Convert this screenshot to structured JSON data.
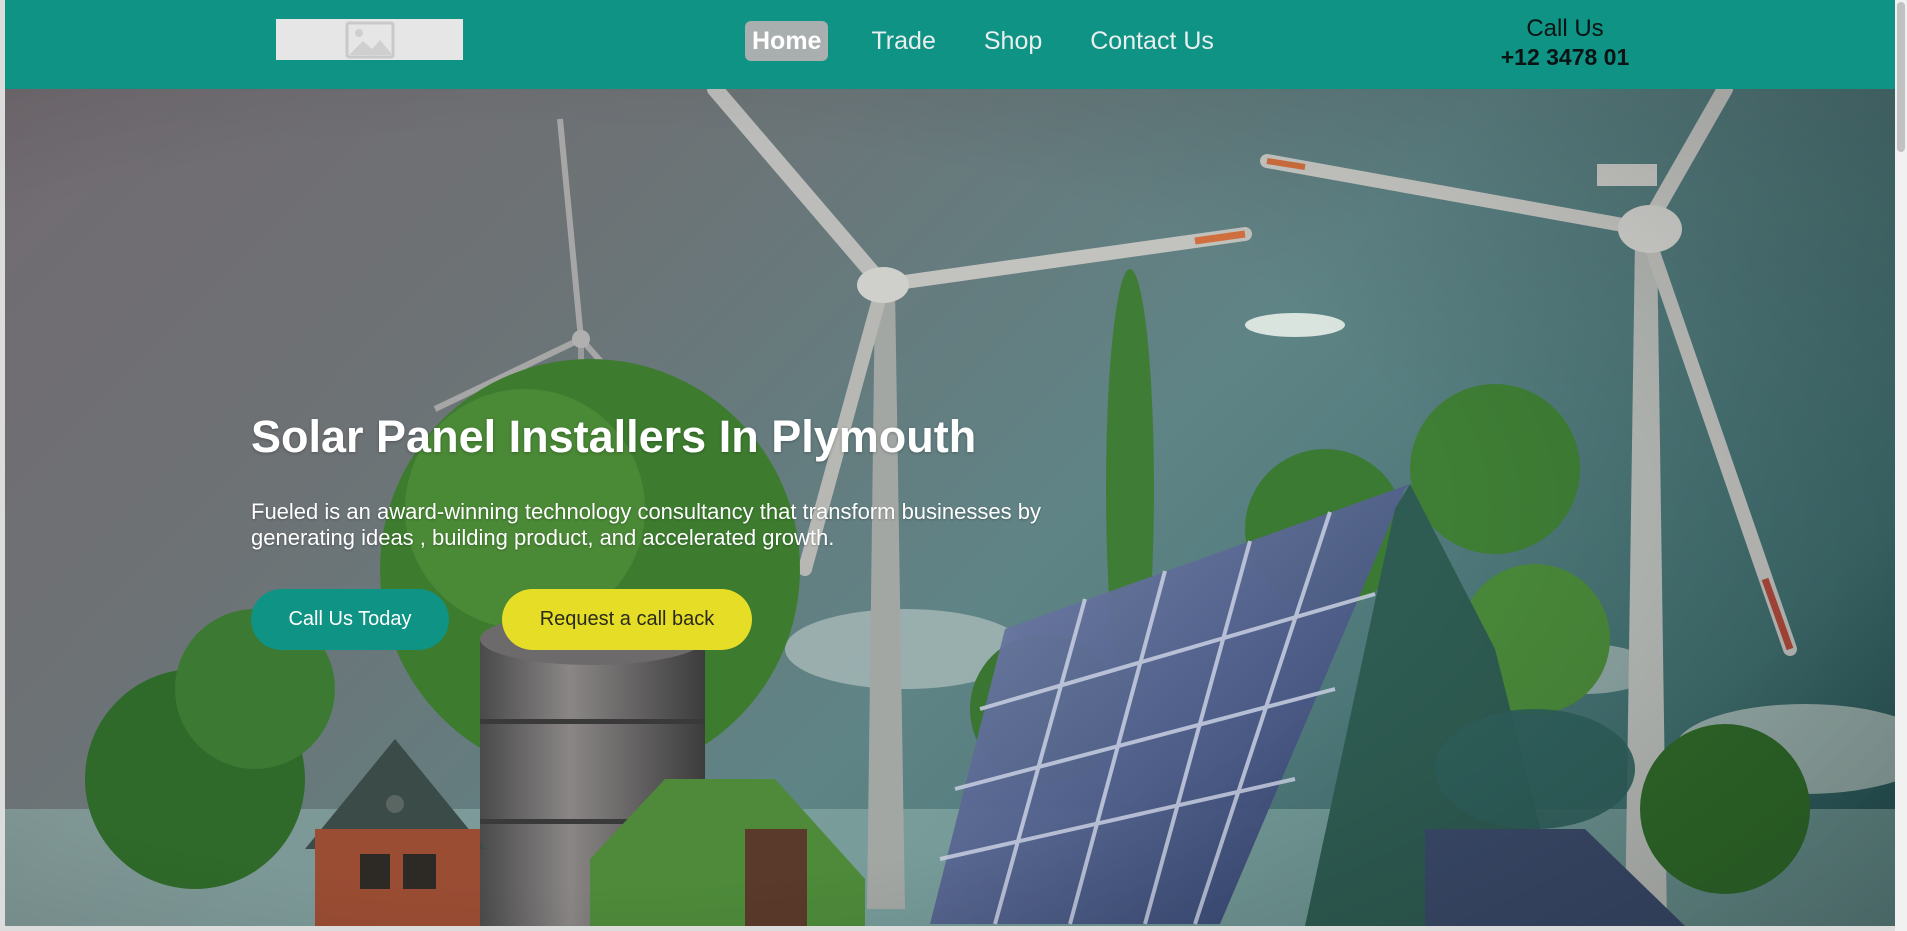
{
  "header": {
    "logo_icon": "image-placeholder-icon",
    "nav": [
      {
        "label": "Home",
        "active": true
      },
      {
        "label": "Trade",
        "active": false
      },
      {
        "label": "Shop",
        "active": false
      },
      {
        "label": "Contact Us",
        "active": false
      }
    ],
    "call_label": "Call Us",
    "call_number": "+12 3478 01"
  },
  "hero": {
    "title": "Solar Panel Installers In Plymouth",
    "description": "Fueled is an award-winning technology consultancy that transform businesses by generating ideas , building product, and accelerated growth.",
    "primary_button": "Call Us Today",
    "secondary_button": "Request a call back"
  },
  "colors": {
    "brand": "#0e9384",
    "accent": "#e6dd27",
    "nav_active_bg": "#a9aeae"
  }
}
